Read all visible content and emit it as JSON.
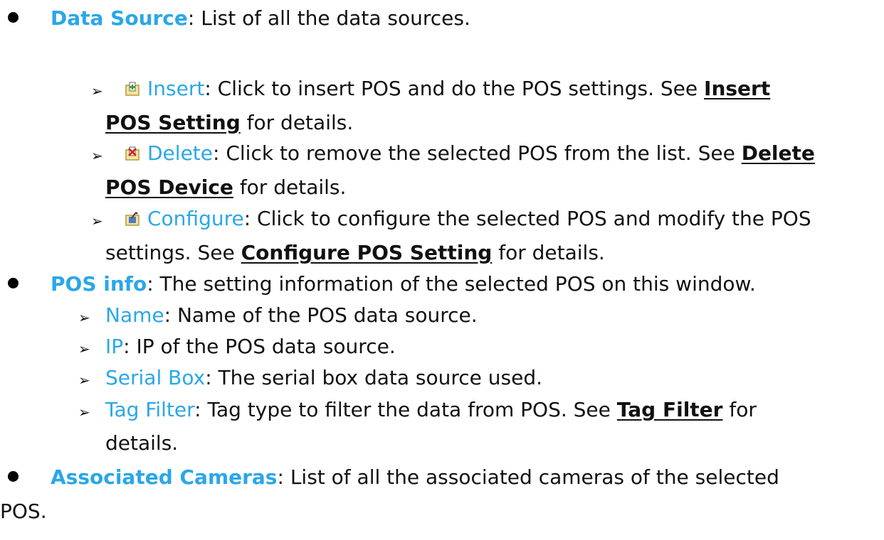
{
  "data_source": {
    "term": "Data Source",
    "text": ": List of all the data sources."
  },
  "actions": {
    "insert": {
      "label": "Insert",
      "text1": ": Click to insert POS and do the POS settings. See ",
      "link_part1": "Insert ",
      "link_part2": "POS Setting",
      "text2": " for details."
    },
    "delete": {
      "label": "Delete",
      "text1": ": Click to remove the selected POS from the list. See ",
      "link_part1": "Delete",
      "link_part2": "POS Device",
      "text2": " for details."
    },
    "configure": {
      "label": "Configure",
      "text1": ": Click to configure the selected POS and modify the POS",
      "text2a": "settings. See ",
      "link": "Configure POS Setting",
      "text2b": " for details."
    }
  },
  "pos_info": {
    "term": "POS info",
    "text": ": The setting information of the selected POS on this window.",
    "items": {
      "name": {
        "label": "Name",
        "text": ": Name of the POS data source."
      },
      "ip": {
        "label": "IP",
        "text": ": IP of the POS data source."
      },
      "serial_box": {
        "label": "Serial Box",
        "text": ": The serial box data source used."
      },
      "tag_filter": {
        "label": "Tag Filter",
        "text1": ": Tag type to filter the data from POS. See ",
        "link": "Tag Filter",
        "text2": " for",
        "text3": "details."
      }
    }
  },
  "associated_cameras": {
    "term": "Associated Cameras",
    "text": ": List of all the associated cameras of the selected",
    "text_cont": "POS."
  }
}
